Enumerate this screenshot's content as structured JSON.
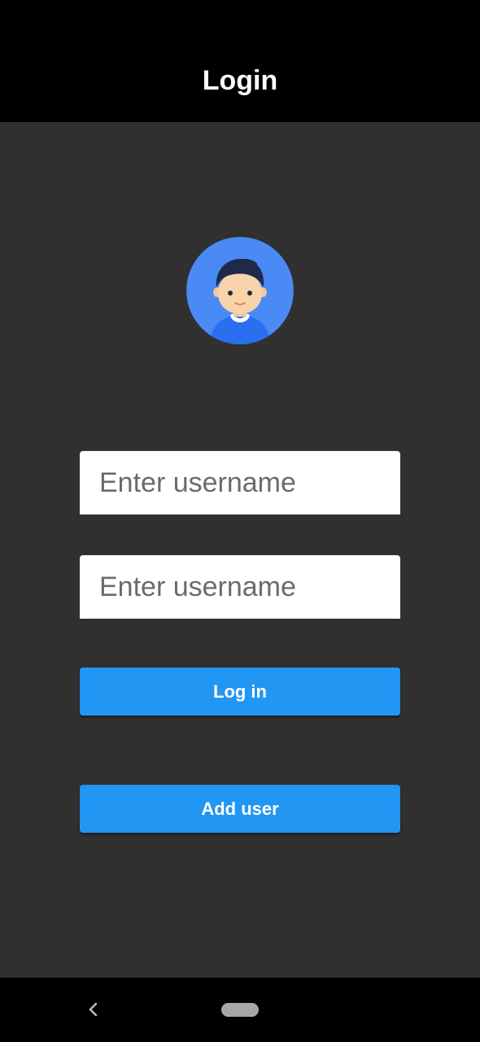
{
  "app_bar": {
    "title": "Login"
  },
  "avatar": {
    "icon": "user-avatar-icon",
    "background_color": "#4a8af4"
  },
  "form": {
    "username_placeholder": "Enter username",
    "password_placeholder": "Enter username",
    "login_label": "Log in",
    "add_user_label": "Add user"
  },
  "colors": {
    "app_bar": "#000000",
    "background": "#303030",
    "button": "#2196f3",
    "field": "#ffffff"
  },
  "nav_bar": {
    "back_icon": "back-chevron-icon",
    "home_icon": "home-pill-icon"
  }
}
